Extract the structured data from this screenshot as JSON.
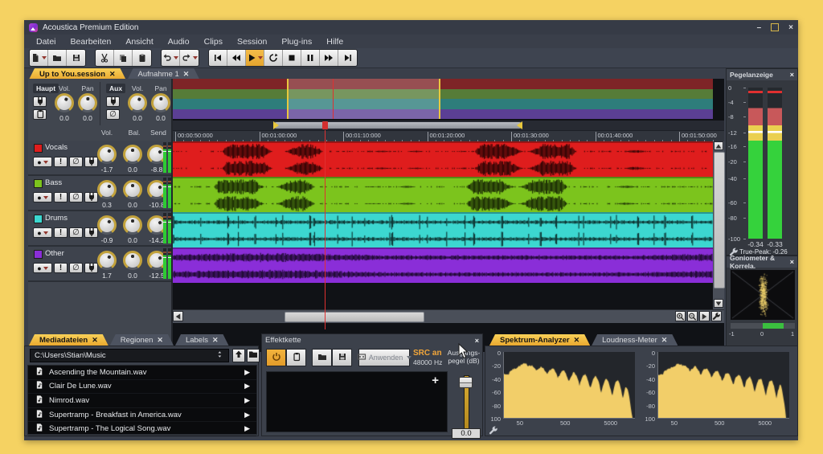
{
  "app": {
    "title": "Acoustica Premium Edition"
  },
  "menu": {
    "items": [
      "Datei",
      "Bearbeiten",
      "Ansicht",
      "Audio",
      "Clips",
      "Session",
      "Plug-ins",
      "Hilfe"
    ]
  },
  "toolbar": {
    "groups": [
      {
        "buttons": [
          {
            "icon": "new-file",
            "dropdown": true
          },
          {
            "icon": "open-folder"
          },
          {
            "icon": "save"
          }
        ]
      },
      {
        "buttons": [
          {
            "icon": "cut"
          },
          {
            "icon": "copy"
          },
          {
            "icon": "paste"
          }
        ]
      },
      {
        "buttons": [
          {
            "icon": "undo",
            "dropdown": true
          },
          {
            "icon": "redo",
            "dropdown": true
          }
        ]
      },
      {
        "buttons": [
          {
            "icon": "skip-start"
          },
          {
            "icon": "rewind"
          },
          {
            "icon": "play",
            "dropdown": true,
            "active": true
          },
          {
            "icon": "loop"
          },
          {
            "icon": "stop"
          },
          {
            "icon": "pause"
          },
          {
            "icon": "fast-forward"
          },
          {
            "icon": "skip-end"
          }
        ]
      }
    ]
  },
  "session_tabs": [
    {
      "label": "Up to You.session",
      "active": true
    },
    {
      "label": "Aufnahme 1",
      "active": false
    }
  ],
  "mixer": {
    "column_headers": [
      "Vol.",
      "Bal.",
      "Send"
    ],
    "master": {
      "label": "Haupt",
      "buttons": [
        "plug",
        "clipboard"
      ],
      "knobs": [
        {
          "label": "Vol.",
          "value": "0.0"
        },
        {
          "label": "Pan",
          "value": "0.0"
        }
      ]
    },
    "aux": {
      "label": "Aux",
      "buttons": [
        "plug",
        "no-entry"
      ],
      "knobs": [
        {
          "label": "Vol.",
          "value": "0.0"
        },
        {
          "label": "Pan",
          "value": "0.0"
        }
      ]
    },
    "tracks": [
      {
        "name": "Vocals",
        "color": "#df1d1d",
        "vol": "-1.7",
        "bal": "0.0",
        "send": "-8.8",
        "style": "bursts",
        "seed": 11
      },
      {
        "name": "Bass",
        "color": "#7cc41d",
        "vol": "0.3",
        "bal": "0.0",
        "send": "-10.8",
        "style": "bursts",
        "seed": 23
      },
      {
        "name": "Drums",
        "color": "#3cd7d0",
        "vol": "-0.9",
        "bal": "0.0",
        "send": "-14.2",
        "style": "spikes",
        "seed": 37
      },
      {
        "name": "Other",
        "color": "#8a2ed8",
        "vol": "1.7",
        "bal": "0.0",
        "send": "-12.5",
        "style": "low",
        "seed": 51
      }
    ]
  },
  "overview_colors": [
    "#7e2427",
    "#567c38",
    "#2e7d7b",
    "#5b3f94"
  ],
  "timeline": {
    "labels": [
      "00:00:50:000",
      "00:01:00:000",
      "00:01:10:000",
      "00:01:20:000",
      "00:01:30:000",
      "00:01:40:000",
      "00:01:50:000"
    ]
  },
  "level_meter": {
    "title": "Pegelanzeige",
    "scale": [
      "0",
      "-4",
      "-8",
      "-12",
      "-16",
      "-20",
      "-40",
      "-60",
      "-80",
      "-100"
    ],
    "values": [
      "-0.34",
      "-0.33"
    ],
    "true_peak": "True-Peak: -0.26"
  },
  "goniometer": {
    "title": "Goniometer & Korrela.",
    "scale_labels": [
      "-1",
      "0",
      "1"
    ]
  },
  "media": {
    "tabs": [
      {
        "label": "Mediadateien",
        "active": true
      },
      {
        "label": "Regionen",
        "active": false
      },
      {
        "label": "Labels",
        "active": false
      }
    ],
    "path": "C:\\Users\\Stian\\Music",
    "files": [
      "Ascending the Mountain.wav",
      "Clair De Lune.wav",
      "Nimrod.wav",
      "Supertramp - Breakfast in America.wav",
      "Supertramp - The Logical Song.wav"
    ]
  },
  "effects": {
    "title": "Effektkette",
    "apply_label": "Anwenden",
    "src_line1": "SRC an",
    "src_line2": "48000 Hz",
    "out_line1": "Ausgangs-",
    "out_line2": "pegel (dB)",
    "output_value": "0.0"
  },
  "analyzer": {
    "tabs": [
      {
        "label": "Spektrum-Analyzer",
        "active": true
      },
      {
        "label": "Loudness-Meter",
        "active": false
      }
    ],
    "y_ticks": [
      "0",
      "-20",
      "-40",
      "-60",
      "-80",
      "100"
    ],
    "x_ticks": [
      "50",
      "500",
      "5000"
    ]
  },
  "colors": {
    "background": "#f5d262",
    "accent_yellow": "#eeb23a",
    "meter_green": "#35d23c",
    "meter_yellow": "#ead04f",
    "meter_red": "#c8585a",
    "spectrum_fill": "#f2ce69"
  }
}
